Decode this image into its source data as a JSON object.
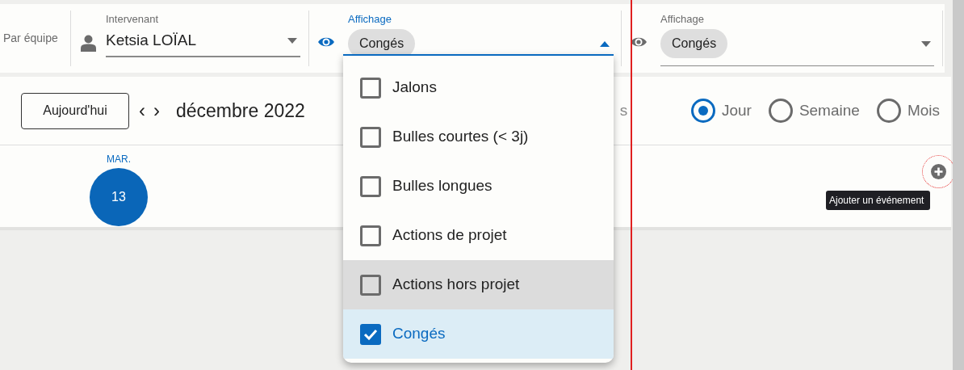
{
  "filters": {
    "team_label": "Par équipe",
    "assignee": {
      "label": "Intervenant",
      "value": "Ketsia LOÏAL"
    },
    "display": {
      "label": "Affichage",
      "chip": "Congés",
      "expanded": true
    },
    "display_2": {
      "label": "Affichage",
      "chip": "Congés",
      "expanded": false
    }
  },
  "calendar": {
    "today_button": "Aujourd'hui",
    "prev": "‹",
    "next": "›",
    "period": "décembre 2022",
    "hidden_fragment": "s",
    "views": [
      {
        "label": "Jour",
        "selected": true
      },
      {
        "label": "Semaine",
        "selected": false
      },
      {
        "label": "Mois",
        "selected": false
      }
    ],
    "day": {
      "weekday": "MAR.",
      "date": "13",
      "today": true
    },
    "add_tooltip": "Ajouter un événement"
  },
  "dropdown": [
    {
      "label": "Jalons",
      "checked": false,
      "highlighted": false
    },
    {
      "label": "Bulles courtes (< 3j)",
      "checked": false,
      "highlighted": false
    },
    {
      "label": "Bulles longues",
      "checked": false,
      "highlighted": false
    },
    {
      "label": "Actions de projet",
      "checked": false,
      "highlighted": false
    },
    {
      "label": "Actions hors projet",
      "checked": false,
      "highlighted": true
    },
    {
      "label": "Congés",
      "checked": true,
      "highlighted": false
    }
  ]
}
